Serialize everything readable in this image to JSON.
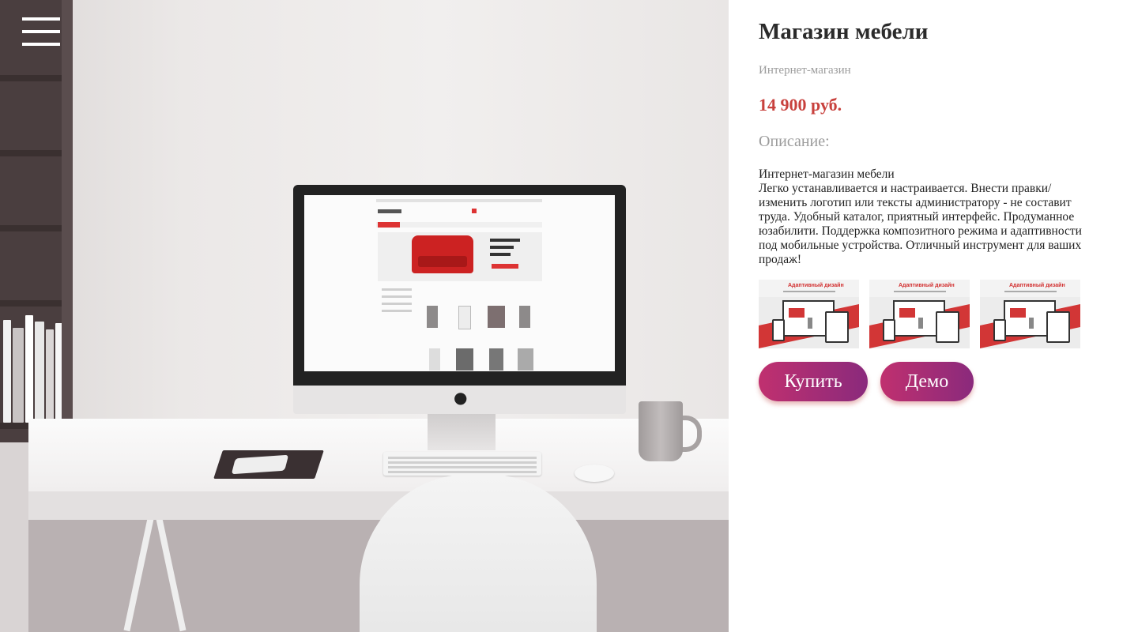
{
  "menu": {
    "icon": "hamburger-menu-icon"
  },
  "hero": {
    "description": "photo"
  },
  "product": {
    "title": "Магазин мебели",
    "category": "Интернет-магазин",
    "price": "14 900 руб.",
    "description_label": "Описание:",
    "description_lines": [
      "Интернет-магазин мебели",
      "Легко устанавливается и настраивается. Внести правки/ изменить логотип или тексты администратору - не составит труда. Удобный каталог, приятный интерфейс. Продуманное юзабилити. Поддержка композитного режима и адаптивности под мобильные устройства. Отличный инструмент для ваших продаж!"
    ],
    "thumbnails": [
      {
        "caption": "Адаптивный дизайн"
      },
      {
        "caption": "Адаптивный дизайн"
      },
      {
        "caption": "Адаптивный дизайн"
      }
    ],
    "buy_label": "Купить",
    "demo_label": "Демо"
  },
  "colors": {
    "price": "#c8413d",
    "button_gradient_start": "#c0306f",
    "button_gradient_end": "#8a2a7c",
    "muted_text": "#9c9c9c"
  }
}
